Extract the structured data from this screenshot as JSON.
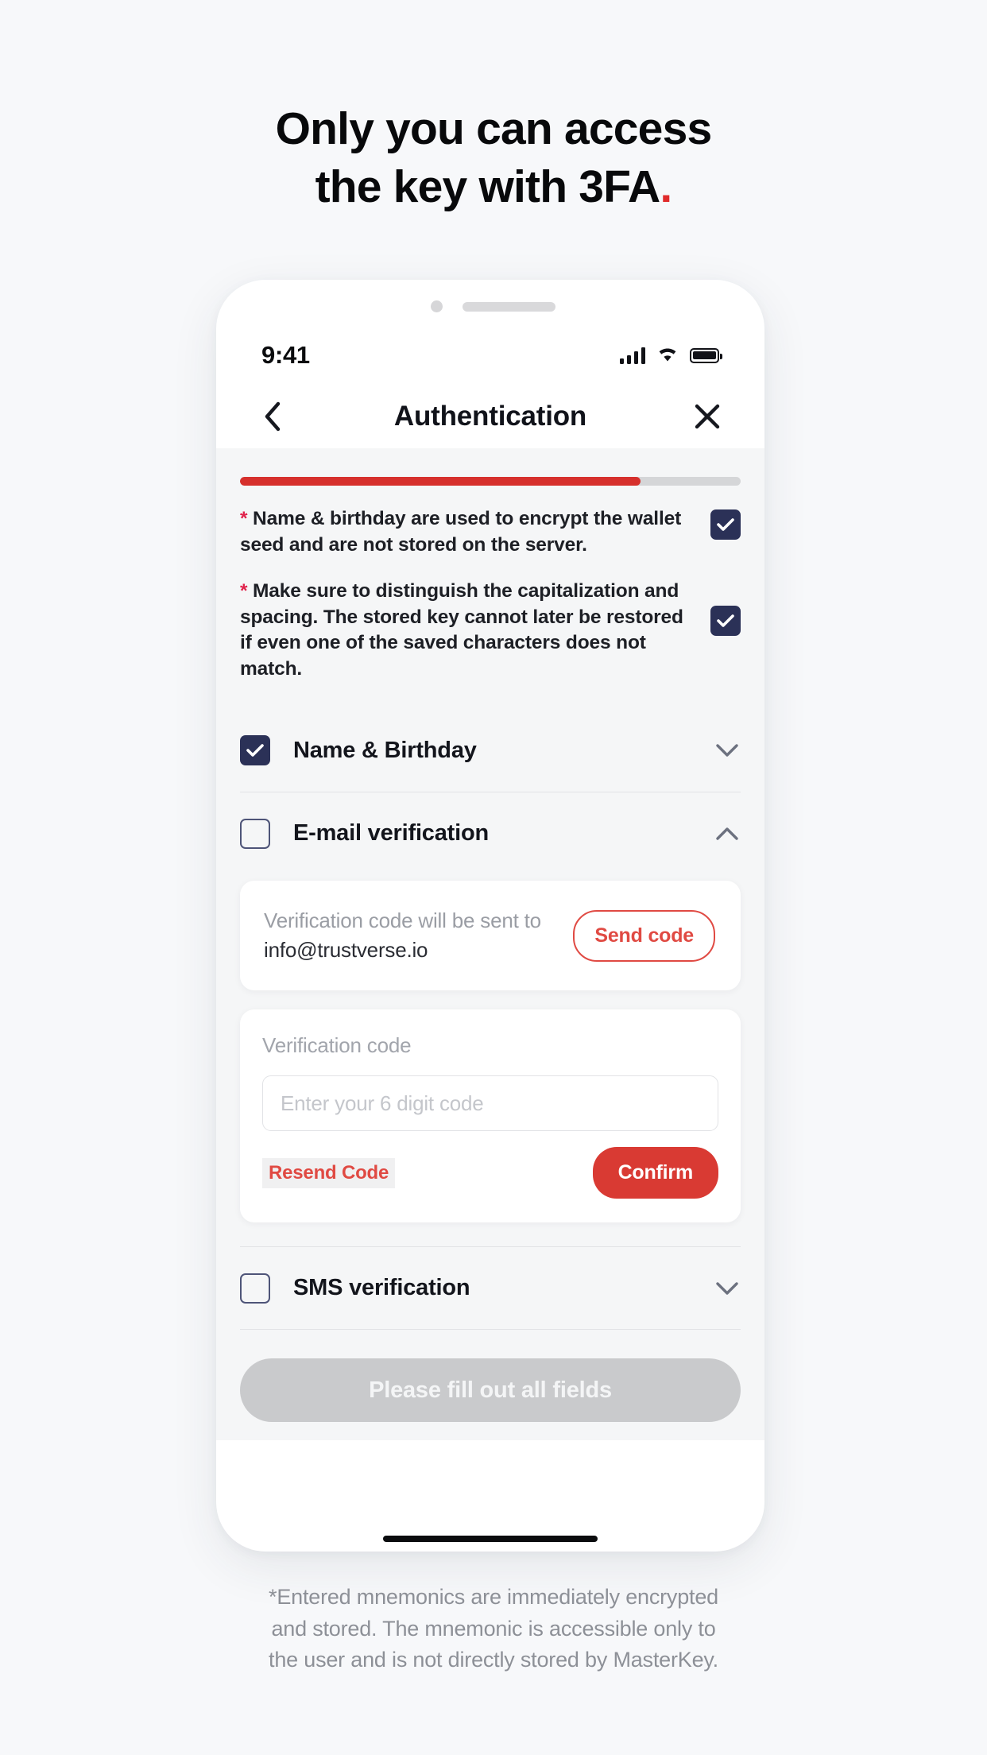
{
  "headline": {
    "line1": "Only you can access",
    "line2": "the key with 3FA",
    "dot": "."
  },
  "phone": {
    "status": {
      "time": "9:41",
      "signal_icon": "cellular-signal-icon",
      "wifi_icon": "wifi-icon",
      "battery_icon": "battery-icon"
    },
    "nav": {
      "back_icon": "chevron-left-icon",
      "title": "Authentication",
      "close_icon": "close-icon"
    },
    "progress": {
      "percent": 80
    },
    "warnings": [
      {
        "star": "*",
        "text": " Name & birthday are used to encrypt the wallet seed and are not stored on the server.",
        "checked": true
      },
      {
        "star": "*",
        "text": " Make sure to distinguish the capitalization and spacing. The stored key cannot later be restored if even one of the saved characters does not match.",
        "checked": true
      }
    ],
    "sections": [
      {
        "label": "Name & Birthday",
        "checked": true,
        "expanded": false,
        "chevron": "chevron-down-icon"
      },
      {
        "label": "E-mail verification",
        "checked": false,
        "expanded": true,
        "chevron": "chevron-up-icon"
      },
      {
        "label": "SMS verification",
        "checked": false,
        "expanded": false,
        "chevron": "chevron-down-icon"
      }
    ],
    "email_panel": {
      "sent_to_label": "Verification code will be sent to",
      "email": "info@trustverse.io",
      "send_code_label": "Send code",
      "code_label": "Verification code",
      "code_placeholder": "Enter your 6 digit code",
      "code_value": "",
      "resend_label": "Resend Code",
      "confirm_label": "Confirm"
    },
    "submit_label": "Please fill out all fields"
  },
  "footer": {
    "line1": "*Entered mnemonics are immediately encrypted",
    "line2": "and stored. The mnemonic is accessible only to",
    "line3": "the user and is not directly stored by MasterKey."
  },
  "colors": {
    "accent_red": "#d6302c",
    "button_red": "#d93a33",
    "outline_red": "#e04a43",
    "checkbox_navy": "#2b3157",
    "star_red": "#e0224b",
    "page_bg": "#f7f8fa",
    "screen_bg": "#f5f6f7",
    "disabled_gray": "#c9cacc"
  }
}
